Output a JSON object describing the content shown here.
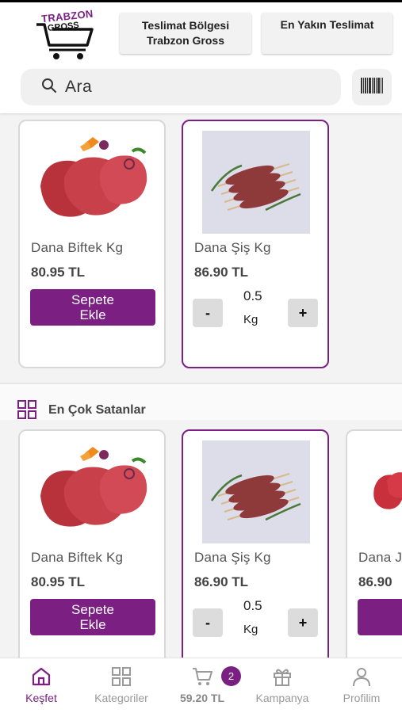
{
  "header": {
    "logo_line1": "TRABZON",
    "logo_line2": "GROSS",
    "delivery_region_title": "Teslimat Bölgesi",
    "delivery_region_value": "Trabzon Gross",
    "nearest_delivery": "En Yakın Teslimat",
    "search_placeholder": "Ara"
  },
  "products_row1": [
    {
      "name": "Dana Biftek Kg",
      "price": "80.95 TL",
      "add_line1": "Sepete",
      "add_line2": "Ekle"
    },
    {
      "name": "Dana Şiş Kg",
      "price": "86.90 TL",
      "qty": "0.5",
      "unit": "Kg",
      "minus": "-",
      "plus": "+"
    }
  ],
  "section": {
    "title": "En Çok Satanlar"
  },
  "products_row2": [
    {
      "name": "Dana Biftek Kg",
      "price": "80.95 TL",
      "add_line1": "Sepete",
      "add_line2": "Ekle"
    },
    {
      "name": "Dana Şiş Kg",
      "price": "86.90 TL",
      "qty": "0.5",
      "unit": "Kg",
      "minus": "-",
      "plus": "+"
    },
    {
      "name": "Dana J",
      "price": "86.90",
      "add_line1": "S"
    }
  ],
  "bottom_nav": {
    "explore": "Keşfet",
    "categories": "Kategoriler",
    "cart_total": "59.20 TL",
    "cart_count": "2",
    "campaigns": "Kampanya",
    "profile": "Profilim"
  },
  "colors": {
    "accent": "#7b1f83",
    "background": "#f3f3f3"
  }
}
